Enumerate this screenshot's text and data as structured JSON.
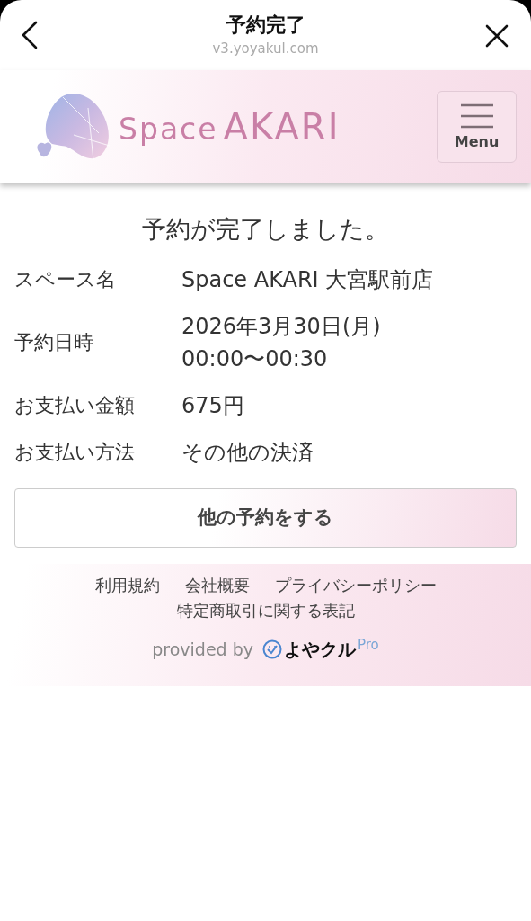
{
  "sheet": {
    "title": "予約完了",
    "url": "v3.yoyakul.com"
  },
  "site": {
    "logo_word_1": "Space",
    "logo_word_2": "AKARI",
    "menu_label": "Menu"
  },
  "heading": "予約が完了しました。",
  "details": [
    {
      "label": "スペース名",
      "values": [
        "Space AKARI 大宮駅前店"
      ]
    },
    {
      "label": "予約日時",
      "values": [
        "2026年3月30日(月)",
        "00:00〜00:30"
      ]
    },
    {
      "label": "お支払い金額",
      "values": [
        "675円"
      ]
    },
    {
      "label": "お支払い方法",
      "values": [
        "その他の決済"
      ]
    }
  ],
  "action_button": "他の予約をする",
  "footer": {
    "links": [
      "利用規約",
      "会社概要",
      "プライバシーポリシー",
      "特定商取引に関する表記"
    ],
    "provided_by": "provided by",
    "brand": "よやクル",
    "brand_suffix": "Pro"
  }
}
